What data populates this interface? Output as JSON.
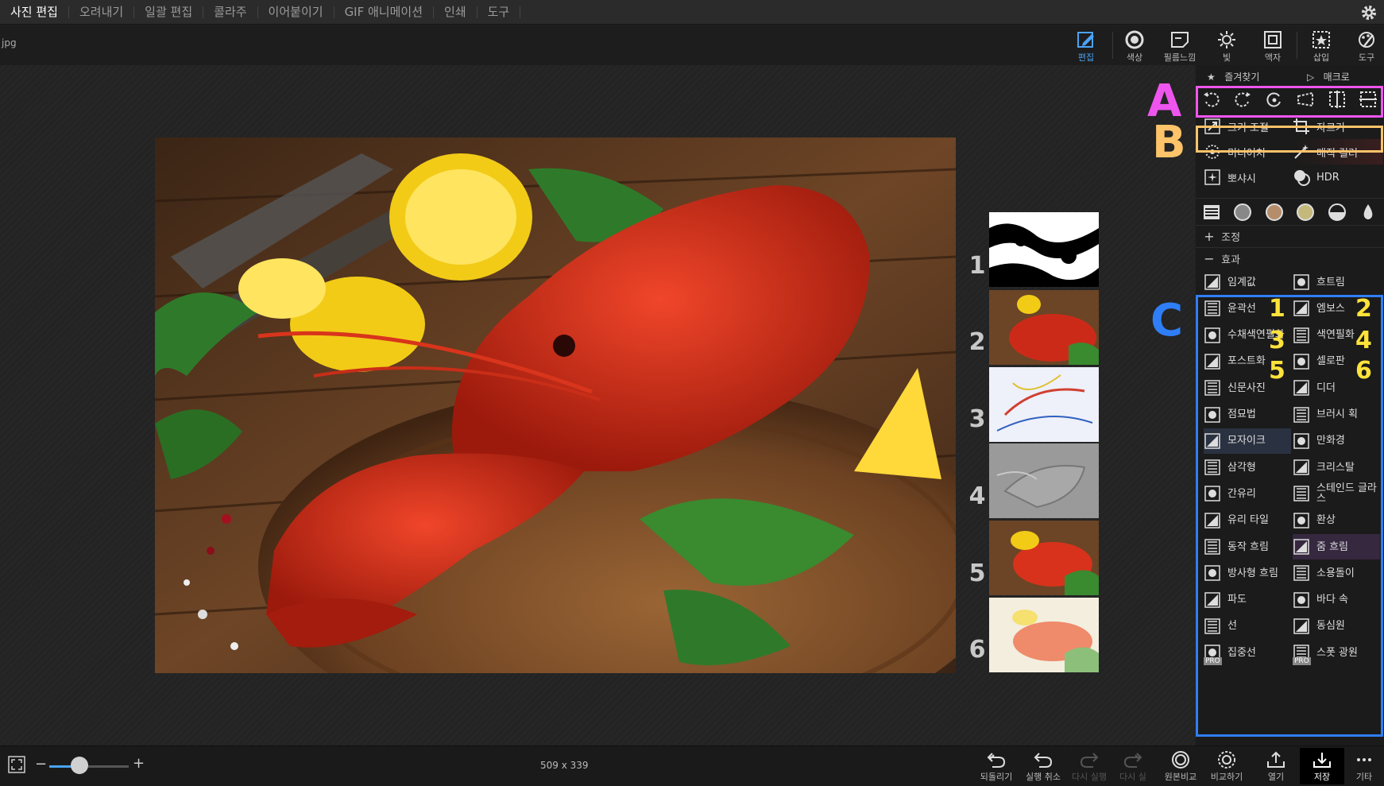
{
  "menu": {
    "items": [
      "사진 편집",
      "오려내기",
      "일괄 편집",
      "콜라주",
      "이어붙이기",
      "GIF 애니메이션",
      "인쇄",
      "도구"
    ],
    "active_index": 0
  },
  "file": {
    "name": "jpg"
  },
  "toolbar": {
    "buttons": [
      {
        "label": "편집",
        "icon": "edit-icon"
      },
      {
        "label": "색상",
        "icon": "color-icon"
      },
      {
        "label": "필름느낌",
        "icon": "film-icon"
      },
      {
        "label": "빛",
        "icon": "light-icon"
      },
      {
        "label": "액자",
        "icon": "frame-icon"
      },
      {
        "label": "삽입",
        "icon": "insert-icon"
      },
      {
        "label": "도구",
        "icon": "tools-icon"
      }
    ],
    "active_label": "편집",
    "accent": "#4aa3f5"
  },
  "panel": {
    "favorites_label": "즐겨찾기",
    "macro_label": "매크로",
    "section_a_icons": [
      "rotate-left-icon",
      "rotate-right-icon",
      "rotate-free-icon",
      "perspective-icon",
      "flip-horizontal-icon",
      "flip-vertical-icon"
    ],
    "resize_label": "크기 조절",
    "crop_label": "자르기",
    "miniature_label": "미니어처",
    "magic_color_label": "매직 컬러",
    "sharpen_label": "뽀샤시",
    "hdr_label": "HDR",
    "presets_icons": [
      "list-icon",
      "preset-gray-icon",
      "preset-warm-icon",
      "preset-tan-icon",
      "half-circle-icon",
      "drop-icon"
    ],
    "adjust_label": "조정",
    "effects_label": "효과",
    "effects": [
      "임계값",
      "흐트림",
      "윤곽선",
      "엠보스",
      "수채색연필화",
      "색연필화",
      "포스트화",
      "셀로판",
      "신문사진",
      "디더",
      "점묘법",
      "브러시 획",
      "모자이크",
      "만화경",
      "삼각형",
      "크리스탈",
      "간유리",
      "스테인드 글라스",
      "유리 타일",
      "환상",
      "동작 흐림",
      "줌 흐림",
      "방사형 흐림",
      "소용돌이",
      "파도",
      "바다 속",
      "선",
      "동심원",
      "집중선",
      "스폿 광원"
    ],
    "pro_badge": "PRO"
  },
  "annotations": {
    "letters": [
      "A",
      "B",
      "C"
    ],
    "numbers": [
      "1",
      "2",
      "3",
      "4",
      "5",
      "6"
    ],
    "colors": {
      "A": "#ee55ee",
      "B": "#ffc36a",
      "C": "#2f7ef7",
      "numbers": "#ffe23a"
    }
  },
  "thumbnails": {
    "labels": [
      "1",
      "2",
      "3",
      "4",
      "5",
      "6"
    ]
  },
  "bottom": {
    "zoom_fraction": 0.38,
    "dimensions": "509 x 339",
    "buttons": [
      {
        "label": "되돌리기",
        "icon": "revert-icon",
        "enabled": true
      },
      {
        "label": "실행 취소",
        "icon": "undo-icon",
        "enabled": true
      },
      {
        "label": "다시 실행",
        "icon": "redo-icon",
        "enabled": false
      },
      {
        "label": "다시 실",
        "icon": "redo-all-icon",
        "enabled": false
      },
      {
        "label": "원본비교",
        "icon": "compare-original-icon",
        "enabled": true
      },
      {
        "label": "비교하기",
        "icon": "compare-icon",
        "enabled": true
      },
      {
        "label": "열기",
        "icon": "open-icon",
        "enabled": true
      },
      {
        "label": "저장",
        "icon": "save-icon",
        "enabled": true
      },
      {
        "label": "기타",
        "icon": "more-icon",
        "enabled": true
      }
    ]
  }
}
